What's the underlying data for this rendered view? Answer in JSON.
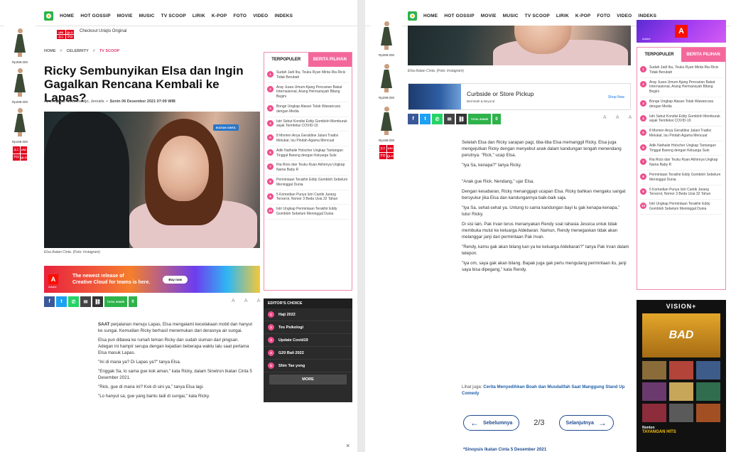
{
  "nav": {
    "items": [
      "HOME",
      "HOT GOSSIP",
      "MOVIE",
      "MUSIC",
      "TV SCOOP",
      "LIRIK",
      "K-POP",
      "FOTO",
      "VIDEO",
      "INDEKS"
    ]
  },
  "rail": {
    "prices": [
      "Rp399.000",
      "Rp299.000",
      "Rp199.000"
    ],
    "uniqlo": [
      "UNI",
      "QLO",
      "ユニ",
      "クロ"
    ]
  },
  "checkout": "Checkout Uniqlo Original",
  "article": {
    "breadcrumb": [
      "HOME",
      "CELEBRITY",
      "TV SCOOP"
    ],
    "title": "Ricky Sembunyikan Elsa dan Ingin Gagalkan Rencana Kembali ke Lapas?",
    "author": "Ayuningtyas Notonihardjo, Jernalis",
    "date": "Senin 06 Desember 2021 07:09 WIB",
    "photo_badge": "IKATAN CINTA",
    "caption": "Elsa Ikatan Cinta. (Foto: Instagram)",
    "share_total_label": "TOTAL SHARE",
    "share_count": "0",
    "font_size_label": "A A A",
    "paragraphs_left": [
      {
        "lead": "SAAT",
        "text": " perjalanan menuju Lapas, Elsa mengalami kecelakaan mobil dan hanyut ke sungai. Kemudian Ricky berhasil menemukan dari derasnya air sungai."
      },
      {
        "lead": "",
        "text": "Elsa pun dibawa ke rumah teman Ricky dan sudah siuman dari pingsan. Adegan ini hampir serupa dengan kejadian beberapa waktu lalu saat pertama Elsa masuk Lapas."
      },
      {
        "lead": "",
        "text": "\"Ini di mana ya? Di Lapas ya?\" tanya Elsa."
      },
      {
        "lead": "",
        "text": "\"Enggak Sa, lo sama gue kok aman,\" kata Ricky, dalam Sinetron Ikatan Cinta 5 Desember 2021."
      },
      {
        "lead": "",
        "text": "\"Rick, gue di mana ini? Kok di sini ya,\" tanya Elsa lagi."
      },
      {
        "lead": "",
        "text": "\"Lo hanyut sa, gue yang bantu tadi di sungai,\" kata Ricky."
      }
    ],
    "paragraphs_right": [
      "Setelah Elsa dan Ricky sarapan pagi, tiba-tiba Elsa memanggil Ricky. Elsa juga mengejutkan Ricky dengan menyebut anak dalam kandungan tengah menendang perutnya. \"Rick,\" ucap Elsa.",
      "\"Iya Sa, kenapa?\" tanya Ricky.",
      "\"Anak gue Rick. Nendang,\" ujar Elsa.",
      "Dengan kesabaran, Ricky menanggapi ucapan Elsa. Ricky bahkan mengaku sangat bersyukur jika Elsa dan kandungannya baik-baik saja.",
      "\"Iya Sa, sehat-sehat ya. Untung lo sama kandungan bayi lu gak kenapa-kenapa,\" tutur Ricky.",
      "Di sisi lain, Pak Irvan terus menanyakan Rendy soal rahasia Jessica untuk tidak membuka mulut ke keluarga Aldebaran. Namun, Rendy menegaskan tidak akan melanggar janji dari permintaan Pak Irvan.",
      "\"Rendy, kamu gak akan bilang kan ya ke keluarga Aldebaran?\" tanya Pak Irvan dalam telepon.",
      "\"Iya om, saya gak akan bilang. Bapak juga gak perlu mengulang permintaan itu, janji saya bisa dipegang,\" kata Rendy."
    ],
    "see_also_label": "Lihat juga:",
    "see_also_link": "Cerita Menyedihkan Boah dan Musdalifah Saat Manggung Stand Up Comedy",
    "next_teaser": "*Sinopsis Ikatan Cinta 5 Desember 2021"
  },
  "ad_adobe": {
    "brand": "Adobe",
    "line1": "The newest release of",
    "line2": "Creative Cloud for teams is here.",
    "cta": "Buy now"
  },
  "ad_curbside": {
    "title": "Curbside or Store Pickup",
    "sub": "Bed Bath & Beyond",
    "cta": "Shop Now"
  },
  "sidebar": {
    "tab_active": "TERPOPULER",
    "tab_inactive": "BERITA PILIHAN",
    "items": [
      "Sudah Jadi Ibu, Teuku Ryan Minta Ria Ricis Tidak Berubah",
      "Aray Juara Umum Ajang Pencarian Bakat Internasional, Arang Hermansyah Bilang Begini",
      "Bonge Ungkap Alasan Tolak Wawancara dengan Media",
      "Istri Sebut Kondisi Eddy Gombloh Memburuk sejak Terinfeksi COVID-19",
      "8 Momen Anya Geraldine Jalani Tradisi Melukat, Isu Pindah Agama Mencuat",
      "Adik Nathalie Holscher Ungkap Tantangan Tinggal Bareng dengan Keluarga Sule",
      "Ria Ricis dan Teuku Ryan Akhirnya Ungkap Nama Baby R",
      "Permintaan Terakhir Eddy Gombloh Sebelum Meninggal Dunia",
      "5 Komedian Punya Istri Cantik Jarang Tersorot, Nomor 3 Beda Usia 32 Tahun",
      "Istri Ungkap Permintaan Terakhir Eddy Gombloh Sebelum Meninggal Dunia"
    ]
  },
  "editors_choice": {
    "title": "EDITOR'S CHOICE",
    "items": [
      "Haji 2022",
      "Tes Psikologi",
      "Update Covid19",
      "G20 Bali 2022",
      "Shin Tae yong"
    ],
    "more": "MORE"
  },
  "pager": {
    "prev": "Sebelumnya",
    "next": "Selanjutnya",
    "current": "2/3"
  },
  "vision_ad": {
    "brand": "VISION+",
    "hero": "BAD",
    "foot_small": "Nonton",
    "foot_big": "TAYANGAN HITS"
  },
  "adobe_sq": "Adobe",
  "close": "×"
}
